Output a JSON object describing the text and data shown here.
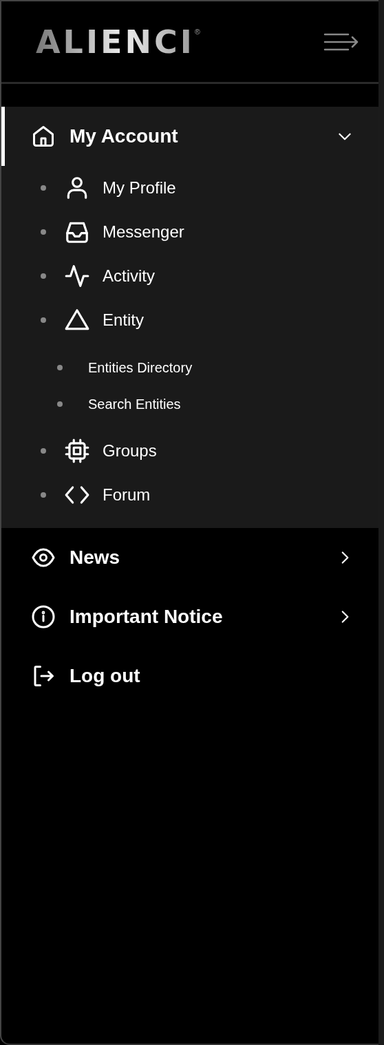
{
  "logo": {
    "text": "ALIENCI",
    "mark": "®"
  },
  "menu": [
    {
      "kind": "group",
      "label": "My Account",
      "selected": true,
      "expanded": true,
      "children": [
        {
          "label": "My Profile"
        },
        {
          "label": "Messenger"
        },
        {
          "label": "Activity"
        },
        {
          "label": "Entity",
          "children": [
            {
              "label": "Entities Directory"
            },
            {
              "label": "Search Entities"
            }
          ]
        },
        {
          "label": "Groups"
        },
        {
          "label": "Forum"
        }
      ]
    },
    {
      "kind": "group",
      "label": "News",
      "selected": false,
      "expanded": false
    },
    {
      "kind": "group",
      "label": "Important Notice",
      "selected": false,
      "expanded": false
    },
    {
      "kind": "link",
      "label": "Log out",
      "selected": false
    }
  ]
}
